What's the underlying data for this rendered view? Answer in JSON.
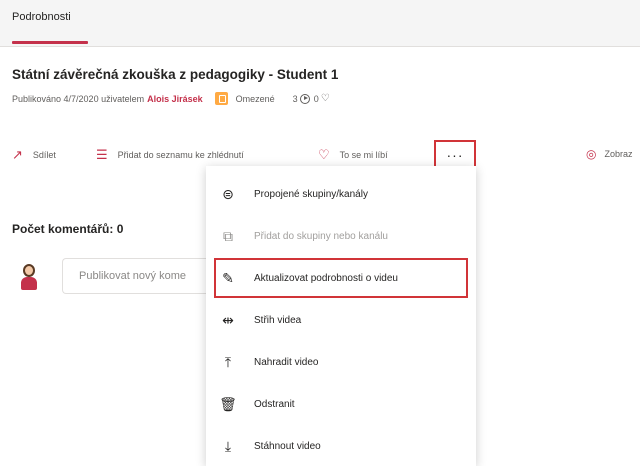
{
  "tabs": [
    {
      "label": "Podrobnosti",
      "active": true
    }
  ],
  "video": {
    "title": "Státní závěrečná zkouška z pedagogiky - Student 1",
    "published_prefix": "Publikováno 4/7/2020 uživatelem",
    "author": "Alois Jirásek",
    "visibility": "Omezené",
    "views": "3",
    "likes": "0"
  },
  "actions": {
    "share": "Sdílet",
    "watchlist": "Přidat do seznamu ke zhlédnutí",
    "like": "To se mi líbí",
    "more": "···",
    "view": "Zobraz"
  },
  "comments": {
    "count_label": "Počet komentářů: 0",
    "placeholder": "Publikovat nový kome"
  },
  "menu": {
    "items": [
      {
        "label": "Propojené skupiny/kanály",
        "icon": "linked-groups-icon",
        "disabled": false
      },
      {
        "label": "Přidat do skupiny nebo kanálu",
        "icon": "add-to-group-icon",
        "disabled": true
      },
      {
        "label": "Aktualizovat podrobnosti o videu",
        "icon": "pencil-icon",
        "disabled": false,
        "selected": true
      },
      {
        "label": "Střih videa",
        "icon": "trim-icon",
        "disabled": false
      },
      {
        "label": "Nahradit video",
        "icon": "upload-icon",
        "disabled": false
      },
      {
        "label": "Odstranit",
        "icon": "trash-icon",
        "disabled": false
      },
      {
        "label": "Stáhnout video",
        "icon": "download-icon",
        "disabled": false
      }
    ]
  },
  "colors": {
    "accent": "#c4314b",
    "highlight": "#d13438",
    "badge": "#ffaa44"
  }
}
